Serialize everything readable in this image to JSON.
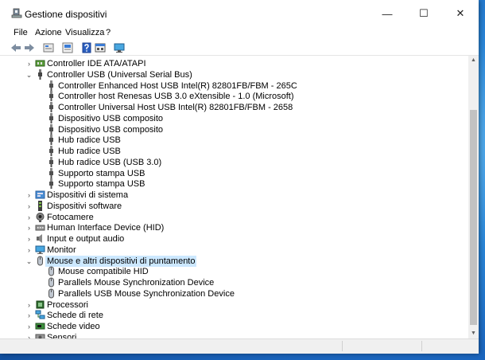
{
  "window": {
    "title": "Gestione dispositivi",
    "controls": {
      "minimize": "—",
      "maximize": "☐",
      "close": "✕"
    }
  },
  "menu": [
    "File",
    "Azione",
    "Visualizza",
    "?"
  ],
  "toolbar": [
    "back-arrow-icon",
    "forward-arrow-icon",
    "properties-icon",
    "driver-icon",
    "help-icon",
    "device-view-icon",
    "monitor-icon"
  ],
  "tree": [
    {
      "label": "Controller IDE ATA/ATAPI",
      "level": 0,
      "expander": "›",
      "icon": "ide-controller-icon"
    },
    {
      "label": "Controller USB (Universal Serial Bus)",
      "level": 0,
      "expander": "⌄",
      "icon": "usb-icon"
    },
    {
      "label": "Controller Enhanced Host USB Intel(R) 82801FB/FBM - 265C",
      "level": 1,
      "expander": "",
      "icon": "usb-plug-icon"
    },
    {
      "label": "Controller host Renesas USB 3.0 eXtensible - 1.0 (Microsoft)",
      "level": 1,
      "expander": "",
      "icon": "usb-plug-icon"
    },
    {
      "label": "Controller Universal Host USB Intel(R) 82801FB/FBM - 2658",
      "level": 1,
      "expander": "",
      "icon": "usb-plug-icon"
    },
    {
      "label": "Dispositivo USB composito",
      "level": 1,
      "expander": "",
      "icon": "usb-plug-icon"
    },
    {
      "label": "Dispositivo USB composito",
      "level": 1,
      "expander": "",
      "icon": "usb-plug-icon"
    },
    {
      "label": "Hub radice USB",
      "level": 1,
      "expander": "",
      "icon": "usb-plug-icon"
    },
    {
      "label": "Hub radice USB",
      "level": 1,
      "expander": "",
      "icon": "usb-plug-icon"
    },
    {
      "label": "Hub radice USB (USB 3.0)",
      "level": 1,
      "expander": "",
      "icon": "usb-plug-icon"
    },
    {
      "label": "Supporto stampa USB",
      "level": 1,
      "expander": "",
      "icon": "usb-plug-icon"
    },
    {
      "label": "Supporto stampa USB",
      "level": 1,
      "expander": "",
      "icon": "usb-plug-icon"
    },
    {
      "label": "Dispositivi di sistema",
      "level": 0,
      "expander": "›",
      "icon": "system-devices-icon"
    },
    {
      "label": "Dispositivi software",
      "level": 0,
      "expander": "›",
      "icon": "software-devices-icon"
    },
    {
      "label": "Fotocamere",
      "level": 0,
      "expander": "›",
      "icon": "camera-icon"
    },
    {
      "label": "Human Interface Device (HID)",
      "level": 0,
      "expander": "›",
      "icon": "hid-icon"
    },
    {
      "label": "Input e output audio",
      "level": 0,
      "expander": "›",
      "icon": "speaker-icon"
    },
    {
      "label": "Monitor",
      "level": 0,
      "expander": "›",
      "icon": "monitor-icon"
    },
    {
      "label": "Mouse e altri dispositivi di puntamento",
      "level": 0,
      "expander": "⌄",
      "icon": "mouse-icon",
      "selected": true
    },
    {
      "label": "Mouse compatibile HID",
      "level": 1,
      "expander": "",
      "icon": "mouse-icon"
    },
    {
      "label": "Parallels Mouse Synchronization Device",
      "level": 1,
      "expander": "",
      "icon": "mouse-icon"
    },
    {
      "label": "Parallels USB Mouse Synchronization Device",
      "level": 1,
      "expander": "",
      "icon": "mouse-icon"
    },
    {
      "label": "Processori",
      "level": 0,
      "expander": "›",
      "icon": "processor-icon"
    },
    {
      "label": "Schede di rete",
      "level": 0,
      "expander": "›",
      "icon": "network-adapter-icon"
    },
    {
      "label": "Schede video",
      "level": 0,
      "expander": "›",
      "icon": "display-adapter-icon"
    },
    {
      "label": "Sensori",
      "level": 0,
      "expander": "›",
      "icon": "sensor-icon"
    }
  ],
  "colors": {
    "selection": "#cce8ff",
    "desktop": "#1a74c9",
    "usb_icon": "#505050"
  }
}
